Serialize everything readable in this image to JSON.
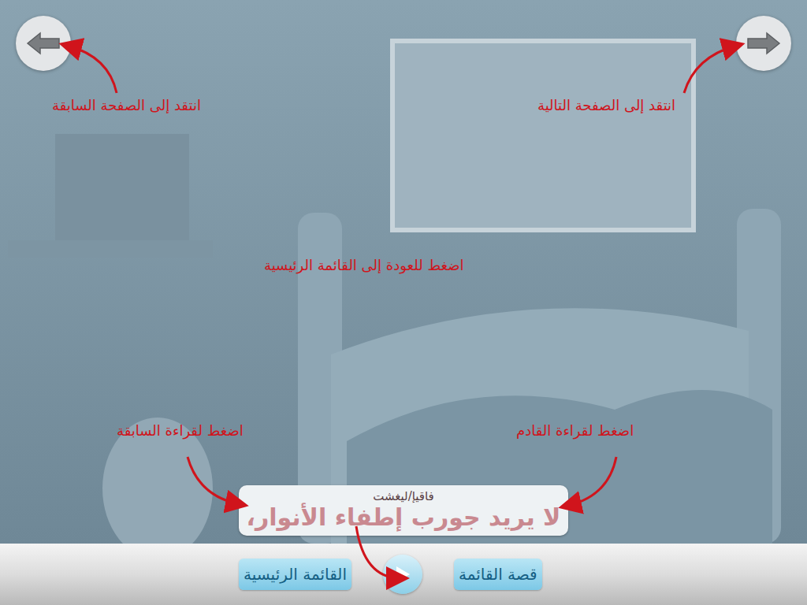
{
  "annotations": [
    {
      "text": "انتقد إلى الصفحة السابقة"
    },
    {
      "text": "انتقد إلى الصفحة التالية"
    },
    {
      "text": "اضغط للعودة إلى القائمة الرئيسية"
    },
    {
      "text": "اضغط لقراءة السابقة"
    },
    {
      "text": "اضغط لقراءة القادم"
    }
  ],
  "caption": {
    "text": "لا يريد جورب إطفاء الأنوار،",
    "toggle_label": "فاقيإ/ليغشت"
  },
  "toolbar": {
    "buttons": [
      {
        "label": "القائمة الرئيسية"
      },
      {
        "label": "قصة القائمة"
      }
    ]
  }
}
